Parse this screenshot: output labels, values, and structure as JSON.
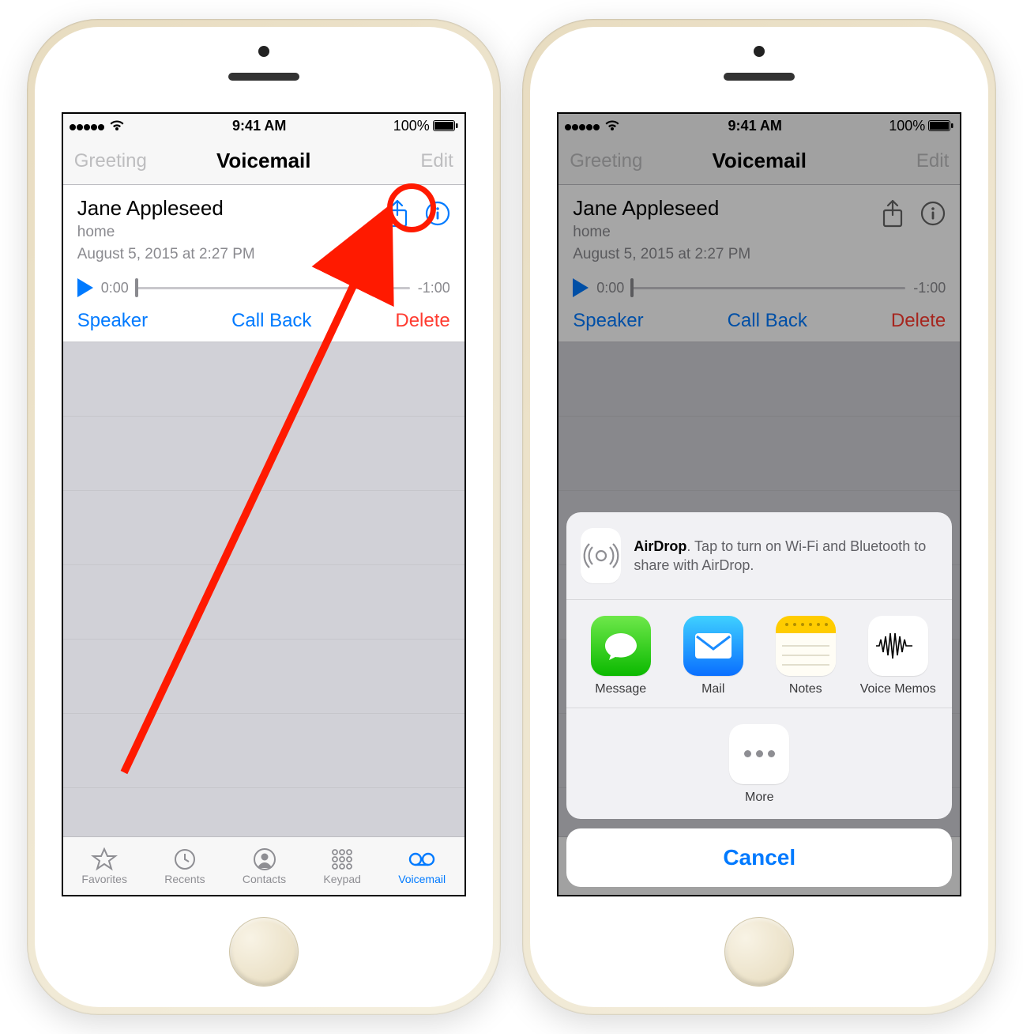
{
  "status": {
    "time": "9:41 AM",
    "battery": "100%"
  },
  "nav": {
    "left": "Greeting",
    "title": "Voicemail",
    "right": "Edit"
  },
  "vm": {
    "name": "Jane Appleseed",
    "label": "home",
    "datetime": "August 5, 2015 at 2:27 PM",
    "elapsed": "0:00",
    "remaining": "-1:00"
  },
  "actions": {
    "speaker": "Speaker",
    "callback": "Call Back",
    "delete": "Delete"
  },
  "tabs": {
    "favorites": "Favorites",
    "recents": "Recents",
    "contacts": "Contacts",
    "keypad": "Keypad",
    "voicemail": "Voicemail"
  },
  "share": {
    "airdrop_label": "AirDrop",
    "airdrop_text": ". Tap to turn on Wi-Fi and Bluetooth to share with AirDrop.",
    "apps": {
      "message": "Message",
      "mail": "Mail",
      "notes": "Notes",
      "voicememos": "Voice Memos"
    },
    "more": "More",
    "cancel": "Cancel"
  }
}
